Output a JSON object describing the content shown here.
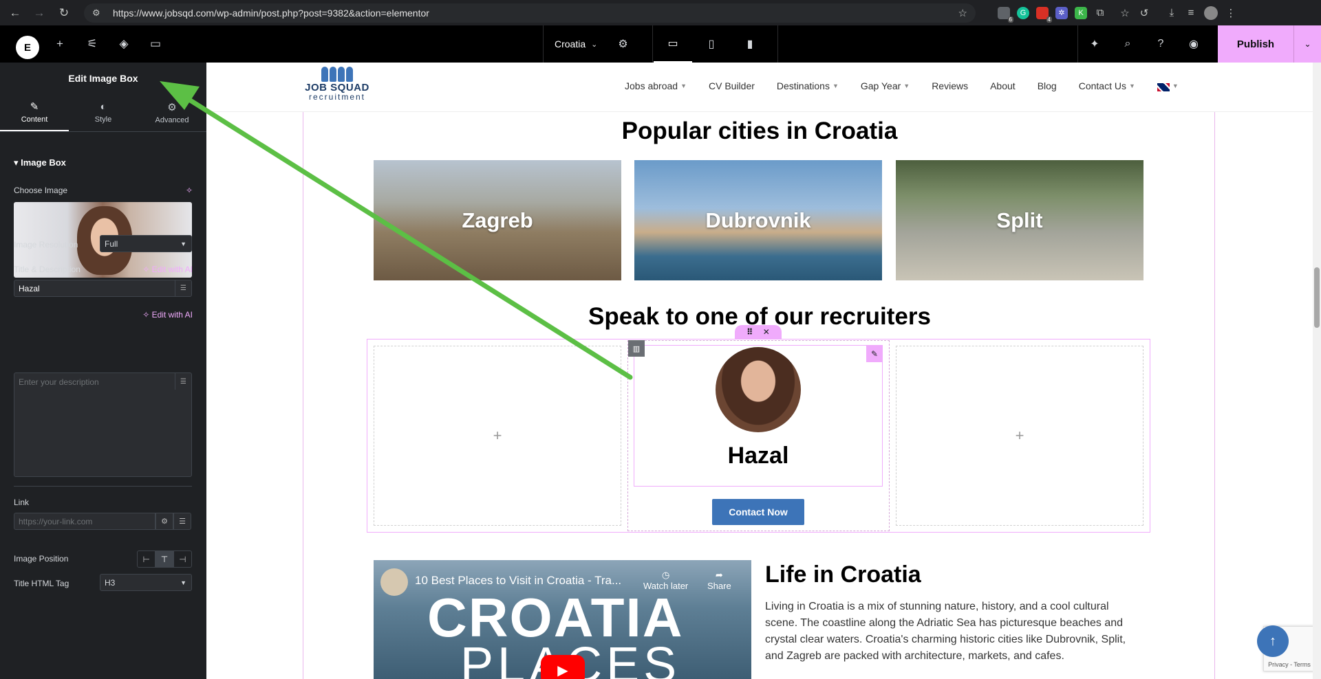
{
  "browser": {
    "url": "https://www.jobsqd.com/wp-admin/post.php?post=9382&action=elementor",
    "ext_badges": [
      "6",
      "4"
    ]
  },
  "elementor": {
    "logo": "E",
    "page_name": "Croatia",
    "publish_label": "Publish"
  },
  "panel": {
    "title": "Edit Image Box",
    "tabs": [
      {
        "label": "Content",
        "icon": "pencil-icon"
      },
      {
        "label": "Style",
        "icon": "contrast-icon"
      },
      {
        "label": "Advanced",
        "icon": "gear-icon"
      }
    ],
    "section": "Image Box",
    "choose_image_label": "Choose Image",
    "image_resolution_label": "Image Resolution",
    "image_resolution_value": "Full",
    "title_desc_label": "Title & Description",
    "edit_with_ai": "Edit with AI",
    "title_value": "Hazal",
    "description_placeholder": "Enter your description",
    "link_label": "Link",
    "link_placeholder": "https://your-link.com",
    "image_position_label": "Image Position",
    "title_tag_label": "Title HTML Tag",
    "title_tag_value": "H3"
  },
  "site": {
    "logo_line1": "JOB SQUAD",
    "logo_line2": "recruitment",
    "menu": [
      {
        "label": "Jobs abroad",
        "dropdown": true
      },
      {
        "label": "CV Builder",
        "dropdown": false
      },
      {
        "label": "Destinations",
        "dropdown": true
      },
      {
        "label": "Gap Year",
        "dropdown": true
      },
      {
        "label": "Reviews",
        "dropdown": false
      },
      {
        "label": "About",
        "dropdown": false
      },
      {
        "label": "Blog",
        "dropdown": false
      },
      {
        "label": "Contact Us",
        "dropdown": true
      }
    ],
    "popular_heading": "Popular cities in Croatia",
    "cities": [
      "Zagreb",
      "Dubrovnik",
      "Split"
    ],
    "recruiters_heading": "Speak to one of our recruiters",
    "recruiter_name": "Hazal",
    "contact_button": "Contact Now",
    "video_title": "10 Best Places to Visit in Croatia - Tra...",
    "video_big1": "CROATIA",
    "video_big2": "PLACES",
    "watch_later": "Watch later",
    "share": "Share",
    "life_heading": "Life in Croatia",
    "life_text": "Living in Croatia is a mix of stunning nature, history, and a cool cultural scene. The coastline along the Adriatic Sea has picturesque beaches and crystal clear waters. Croatia's charming historic cities like Dubrovnik, Split, and Zagreb are packed with architecture, markets, and cafes.",
    "recaptcha_text": "Privacy - Terms"
  },
  "colors": {
    "accent_pink": "#f0abfc",
    "brand_blue": "#3d74b8",
    "annotation_green": "#5cbf45"
  }
}
